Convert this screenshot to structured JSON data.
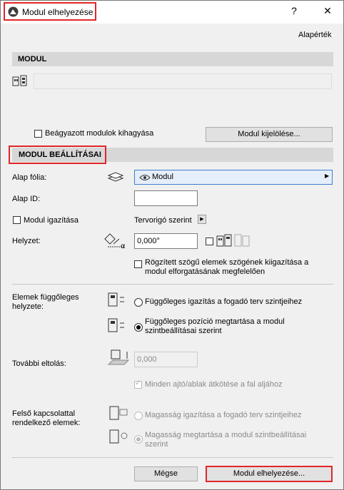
{
  "window": {
    "title": "Modul elhelyezése",
    "help": "?",
    "close": "✕"
  },
  "header": {
    "defaults_link": "Alapérték"
  },
  "modul_section": {
    "title": "MODUL",
    "skip_nested_label": "Beágyazott modulok kihagyása",
    "skip_nested_checked": false,
    "select_button": "Modul kijelölése..."
  },
  "settings_section": {
    "title": "MODUL BEÁLLÍTÁSAI",
    "base_layer_label": "Alap fólia:",
    "base_layer_value": "Modul",
    "base_id_label": "Alap ID:",
    "base_id_value": "",
    "align_label": "Modul igazítása",
    "align_checked": false,
    "align_mode": "Tervorigó szerint",
    "position_label": "Helyzet:",
    "angle_value": "0,000°",
    "mirror_checked": false,
    "adjust_angles_label": "Rögzített szögű elemek szögének kiigazítása a modul elforgatásának megfelelően",
    "adjust_angles_checked": false
  },
  "vertical": {
    "label": "Elemek függőleges helyzete:",
    "option1": "Függőleges igazítás a fogadó terv szintjeihez",
    "option2": "Függőleges pozíció megtartása a modul szintbeállításai szerint",
    "selected": 2
  },
  "offset": {
    "label": "További eltolás:",
    "value": "0,000",
    "relink_label": "Minden ajtó/ablak átkötése a fal aljához",
    "relink_checked": true
  },
  "top_linked": {
    "label": "Felső kapcsolattal rendelkező elemek:",
    "option1": "Magasság igazítása a fogadó terv szintjeihez",
    "option2": "Magasság megtartása a modul szintbeállításai szerint",
    "selected": 2
  },
  "footer": {
    "cancel": "Mégse",
    "place": "Modul elhelyezése..."
  }
}
